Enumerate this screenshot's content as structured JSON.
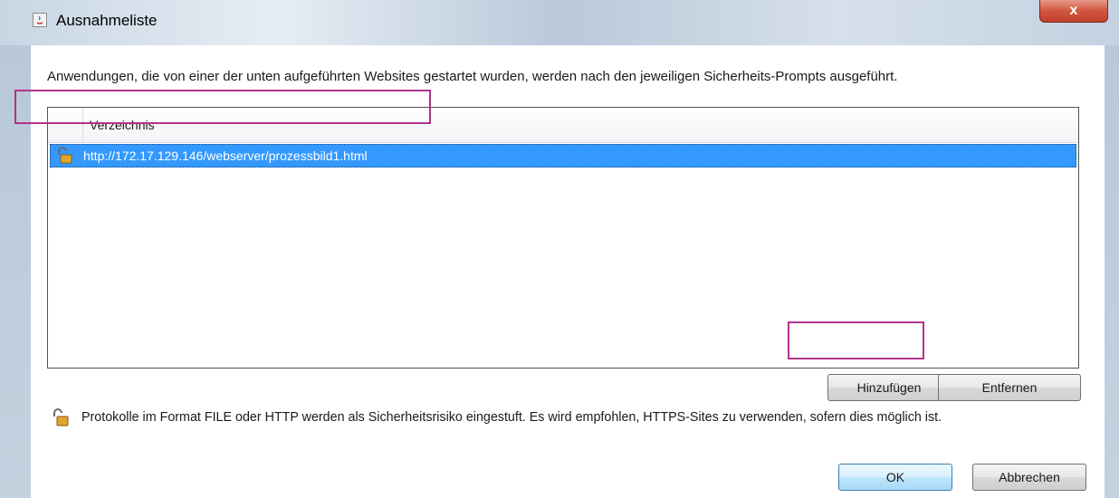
{
  "window": {
    "title": "Ausnahmeliste",
    "close_label": "x"
  },
  "description": "Anwendungen, die von einer der unten aufgeführten Websites gestartet wurden, werden nach den jeweiligen Sicherheits-Prompts ausgeführt.",
  "table": {
    "column_header": "Verzeichnis",
    "rows": [
      {
        "icon": "unlocked-padlock-icon",
        "url": "http://172.17.129.146/webserver/prozessbild1.html",
        "selected": true
      }
    ]
  },
  "buttons": {
    "add": "Hinzufügen",
    "remove": "Entfernen",
    "ok": "OK",
    "cancel": "Abbrechen"
  },
  "warning": {
    "icon": "unlocked-padlock-icon",
    "text": "Protokolle im Format FILE oder HTTP werden als Sicherheitsrisiko eingestuft. Es wird empfohlen, HTTPS-Sites zu verwenden, sofern dies möglich ist."
  },
  "colors": {
    "selection": "#3399ff",
    "highlight_box": "#b0328a",
    "close_button": "#c2402a"
  }
}
